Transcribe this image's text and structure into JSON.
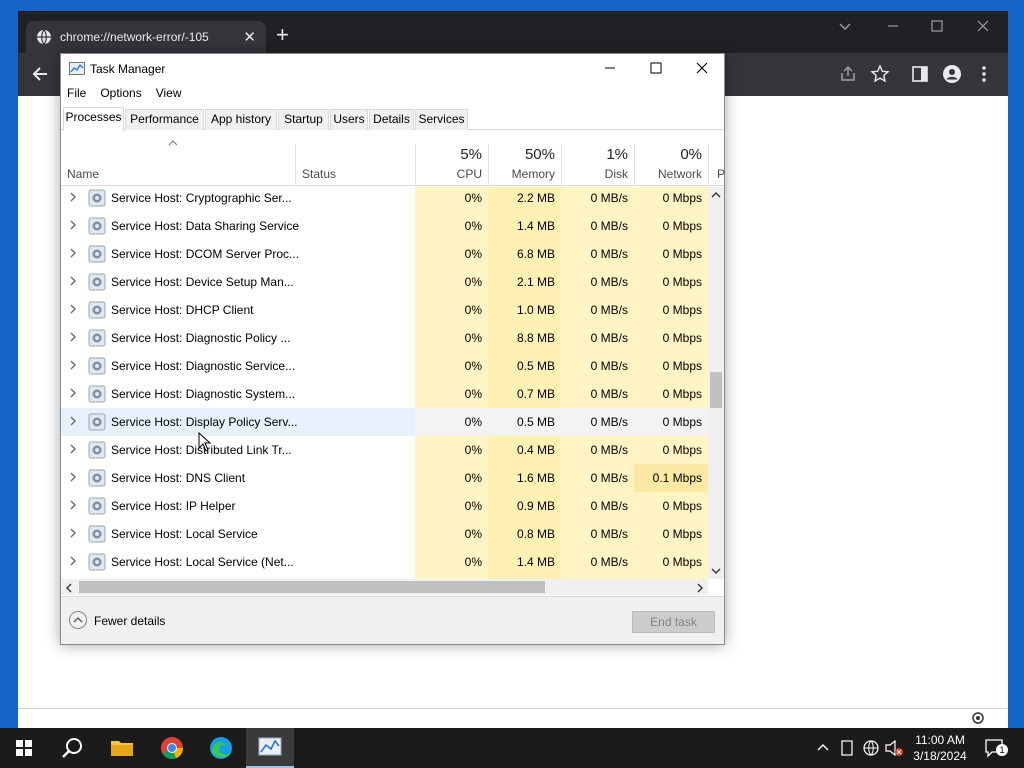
{
  "chrome": {
    "tab_title": "chrome://network-error/-105",
    "tab_close": "✕",
    "new_tab": "+"
  },
  "taskmanager": {
    "title": "Task Manager",
    "menu": [
      "File",
      "Options",
      "View"
    ],
    "tabs": [
      "Processes",
      "Performance",
      "App history",
      "Startup",
      "Users",
      "Details",
      "Services"
    ],
    "columns": {
      "name": "Name",
      "status": "Status",
      "cpu": {
        "pct": "5%",
        "label": "CPU"
      },
      "memory": {
        "pct": "50%",
        "label": "Memory"
      },
      "disk": {
        "pct": "1%",
        "label": "Disk"
      },
      "network": {
        "pct": "0%",
        "label": "Network"
      },
      "power_partial": "P"
    },
    "rows": [
      {
        "name": "Service Host: Cryptographic Ser...",
        "cpu": "0%",
        "memory": "2.2 MB",
        "disk": "0 MB/s",
        "network": "0 Mbps"
      },
      {
        "name": "Service Host: Data Sharing Service",
        "cpu": "0%",
        "memory": "1.4 MB",
        "disk": "0 MB/s",
        "network": "0 Mbps"
      },
      {
        "name": "Service Host: DCOM Server Proc...",
        "cpu": "0%",
        "memory": "6.8 MB",
        "disk": "0 MB/s",
        "network": "0 Mbps"
      },
      {
        "name": "Service Host: Device Setup Man...",
        "cpu": "0%",
        "memory": "2.1 MB",
        "disk": "0 MB/s",
        "network": "0 Mbps"
      },
      {
        "name": "Service Host: DHCP Client",
        "cpu": "0%",
        "memory": "1.0 MB",
        "disk": "0 MB/s",
        "network": "0 Mbps"
      },
      {
        "name": "Service Host: Diagnostic Policy ...",
        "cpu": "0%",
        "memory": "8.8 MB",
        "disk": "0 MB/s",
        "network": "0 Mbps"
      },
      {
        "name": "Service Host: Diagnostic Service...",
        "cpu": "0%",
        "memory": "0.5 MB",
        "disk": "0 MB/s",
        "network": "0 Mbps"
      },
      {
        "name": "Service Host: Diagnostic System...",
        "cpu": "0%",
        "memory": "0.7 MB",
        "disk": "0 MB/s",
        "network": "0 Mbps"
      },
      {
        "name": "Service Host: Display Policy Serv...",
        "cpu": "0%",
        "memory": "0.5 MB",
        "disk": "0 MB/s",
        "network": "0 Mbps"
      },
      {
        "name": "Service Host: Distributed Link Tr...",
        "cpu": "0%",
        "memory": "0.4 MB",
        "disk": "0 MB/s",
        "network": "0 Mbps"
      },
      {
        "name": "Service Host: DNS Client",
        "cpu": "0%",
        "memory": "1.6 MB",
        "disk": "0 MB/s",
        "network": "0.1 Mbps"
      },
      {
        "name": "Service Host: IP Helper",
        "cpu": "0%",
        "memory": "0.9 MB",
        "disk": "0 MB/s",
        "network": "0 Mbps"
      },
      {
        "name": "Service Host: Local Service",
        "cpu": "0%",
        "memory": "0.8 MB",
        "disk": "0 MB/s",
        "network": "0 Mbps"
      },
      {
        "name": "Service Host: Local Service (Net...",
        "cpu": "0%",
        "memory": "1.4 MB",
        "disk": "0 MB/s",
        "network": "0 Mbps"
      }
    ],
    "selected_row": 8,
    "fewer_details": "Fewer details",
    "end_task": "End task"
  },
  "taskbar": {
    "time": "11:00 AM",
    "date": "3/18/2024",
    "notification_count": "1",
    "apps": [
      "start-icon",
      "search-icon",
      "file-explorer-icon",
      "chrome-icon",
      "edge-icon",
      "task-manager-icon"
    ]
  },
  "colors": {
    "chrome_dark": "#202124",
    "chrome_toolbar": "#35363a",
    "heat_light": "#fff4c4",
    "heat_memory": "#fff0b4",
    "selected_row": "#e6f1fb",
    "desktop": "#1565c8"
  }
}
